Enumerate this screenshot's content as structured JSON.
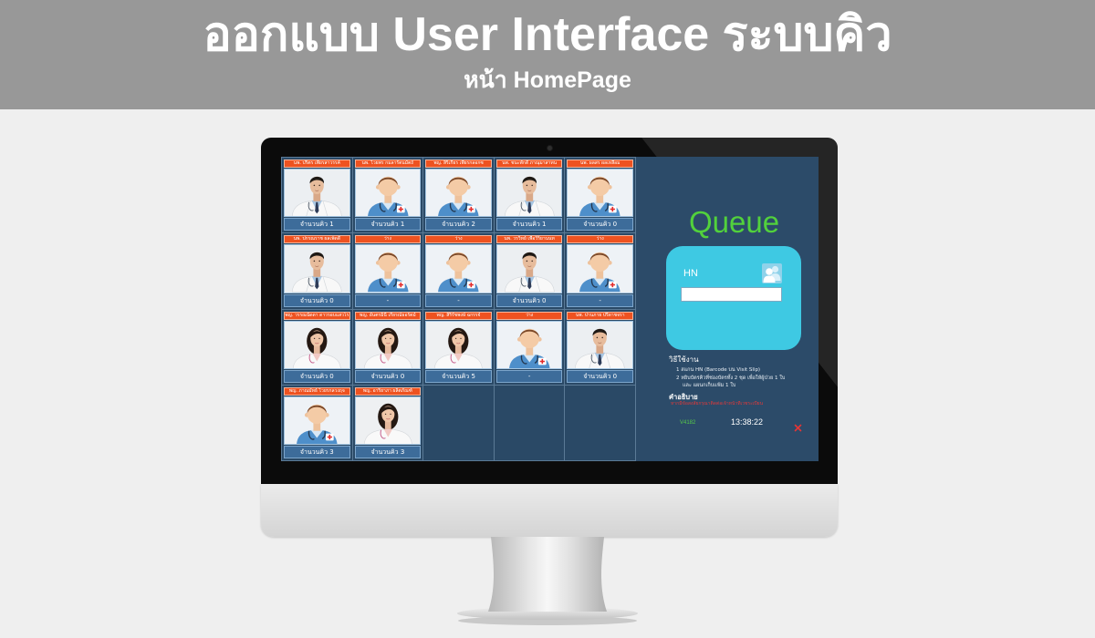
{
  "banner": {
    "title": "ออกแบบ User Interface ระบบคิว",
    "subtitle": "หน้า HomePage"
  },
  "doctors": [
    {
      "name": "นพ. ปริตร เพียรสาวรรค์",
      "queue": "จำนวนคิว 1",
      "avatar": "male-doctor-photo"
    },
    {
      "name": "นพ. ไวยพร กมลารัตนมัตถ์",
      "queue": "จำนวนคิว 1",
      "avatar": "doctor-placeholder-icon"
    },
    {
      "name": "พญ. สิริเกียร เพียรกลอกซ",
      "queue": "จำนวนคิว 2",
      "avatar": "doctor-placeholder-icon"
    },
    {
      "name": "นพ. ชนะพักดี ภาณุมาสาทน",
      "queue": "จำนวนคิว 1",
      "avatar": "male-doctor-photo"
    },
    {
      "name": "นพ. ผลสร ผลเหลือม",
      "queue": "จำนวนคิว 0",
      "avatar": "doctor-placeholder-icon"
    },
    {
      "name": "นพ. ปกรณราช ผลเพ็ดดี",
      "queue": "จำนวนคิว 0",
      "avatar": "male-doctor-photo"
    },
    {
      "name": "ว่าง",
      "queue": "-",
      "avatar": "doctor-placeholder-icon"
    },
    {
      "name": "ว่าง",
      "queue": "-",
      "avatar": "doctor-placeholder-icon"
    },
    {
      "name": "นพ. วรวิทย์ เพื่อวิริยานนท",
      "queue": "จำนวนคิว 0",
      "avatar": "male-doctor-photo"
    },
    {
      "name": "ว่าง",
      "queue": "-",
      "avatar": "doctor-placeholder-icon"
    },
    {
      "name": "พญ. วรรณนัดดา ดาวรอบแสวโร",
      "queue": "จำนวนคิว 0",
      "avatar": "female-doctor-photo"
    },
    {
      "name": "พญ. อันตรมินี เกียรณ์ธอร์ตม์",
      "queue": "จำนวนคิว 0",
      "avatar": "female-doctor-photo"
    },
    {
      "name": "พญ. สิริรัชพงษ์ ฉกรรจ์",
      "queue": "จำนวนคิว 5",
      "avatar": "female-doctor-photo"
    },
    {
      "name": "ว่าง",
      "queue": "-",
      "avatar": "doctor-placeholder-icon"
    },
    {
      "name": "นพ. ปานภาย ปรีดาชจรา",
      "queue": "จำนวนคิว 0",
      "avatar": "male-doctor-photo"
    },
    {
      "name": "พญ. ภาณมัทธ์ ไวยรกลวงฤจ",
      "queue": "จำนวนคิว 3",
      "avatar": "doctor-placeholder-icon"
    },
    {
      "name": "พญ. อาริยาภา ผลิตภัณฑ์",
      "queue": "จำนวนคิว 3",
      "avatar": "female-doctor-photo"
    }
  ],
  "queue_panel": {
    "title": "Queue",
    "hn_label": "HN",
    "hn_value": "",
    "hn_icon": "user-group-icon",
    "instructions_title": "วิธีใช้งาน",
    "instructions": [
      "1 สแกน HN (Barcode บน Visit Slip)",
      "2 หยิบบัตรคิวที่ช่องบัตรทั้ง 2 ชุด เพื่อให้ผู้ป่วย 1 ใบ",
      "และ แผนกเก็บแฟ้ม 1 ใบ"
    ],
    "description_title": "คำอธิบาย",
    "description": "หากมีข้อสงสัยกรุณาติดต่อเจ้าหน้าที่เวชระเบียน",
    "version": "V4182",
    "clock": "13:38:22",
    "close_icon": "close-icon"
  },
  "colors": {
    "banner": "#989898",
    "screen": "#2a4966",
    "card_header": "#ee5220",
    "queue_title": "#52d13c",
    "hn_box": "#3ec9e3",
    "count_bar": "#3d6c9a",
    "version": "#57c94a",
    "description": "#e03a3a",
    "close": "#e53535"
  }
}
